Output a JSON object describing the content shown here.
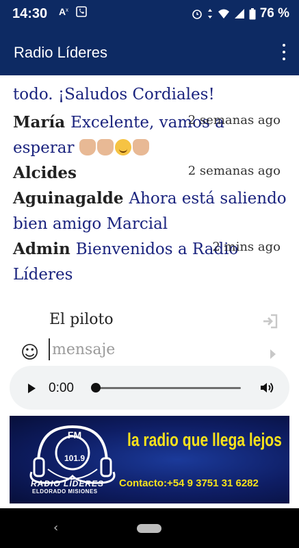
{
  "status_bar": {
    "time": "14:30",
    "left_icons": [
      "translate-icon",
      "phone-app-icon"
    ],
    "right_icons": [
      "alarm-icon",
      "data-arrows-icon",
      "wifi-icon",
      "signal-icon",
      "battery-icon"
    ],
    "battery": "76 %"
  },
  "app_bar": {
    "title": "Radio Líderes",
    "menu_icon": "more-vert-icon",
    "background": "#0d2a63"
  },
  "chat": {
    "partial_top": "todo. ¡Saludos Cordiales!",
    "messages": [
      {
        "author": "María",
        "text": "Excelente, vamos a esperar",
        "time": "2 semanas ago",
        "emojis": [
          "thumbs-up-emoji",
          "raised-hand-emoji",
          "smiling-face-emoji",
          "raised-hand-emoji"
        ]
      },
      {
        "author": "Alcides",
        "text": "",
        "time": "2 semanas ago"
      },
      {
        "author": "Aguinagalde",
        "text": "Ahora está saliendo bien amigo Marcial",
        "time": ""
      },
      {
        "author": "Admin",
        "text": "Bienvenidos a Radio Líderes",
        "time": "2 mins ago"
      }
    ],
    "message_color": "#1a237e"
  },
  "composer": {
    "name_value": "El piloto",
    "message_placeholder": "mensaje",
    "smiley_icon": "smiley-icon",
    "login_icon": "login-icon",
    "send_icon": "send-arrow-icon"
  },
  "audio_player": {
    "time": "0:00",
    "progress": 0,
    "play_icon": "play-icon",
    "volume_icon": "volume-icon"
  },
  "banner": {
    "fm": "FM",
    "frequency": "101.9",
    "brand": "RADIO LÍDERES",
    "location": "ELDORADO MISIONES",
    "slogan": "la radio que llega lejos",
    "contact": "Contacto:+54 9 3751 31 6282",
    "slogan_color": "#f7e21b"
  },
  "nav_bar": {
    "back_icon": "back-chevron-icon",
    "home_icon": "home-pill-icon",
    "back_glyph": "‹"
  }
}
